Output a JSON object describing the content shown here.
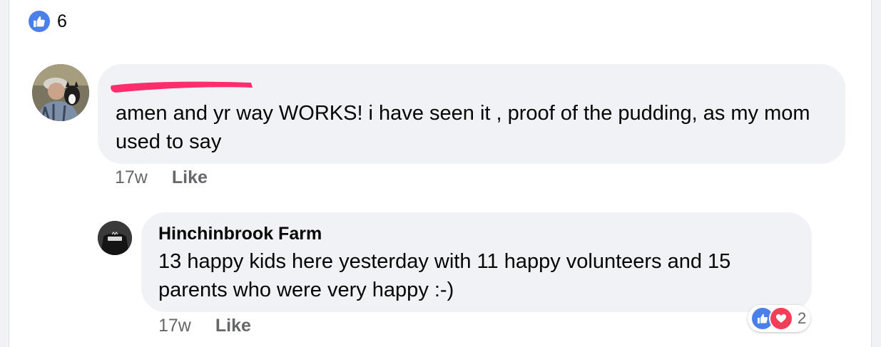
{
  "reaction_summary": {
    "icon": "like-icon",
    "count": "6",
    "color": "#4a80e8"
  },
  "comments": [
    {
      "author_redacted": true,
      "redaction_color": "#ff2d6b",
      "avatar": "user-photo-avatar",
      "text": "amen and yr way WORKS! i have seen it , proof of the pudding, as my mom used to say",
      "time": "17w",
      "like_label": "Like"
    },
    {
      "author": "Hinchinbrook Farm",
      "avatar": "farm-logo-avatar",
      "text": "13 happy kids here yesterday with 11 happy volunteers and 15 parents who were very happy :-)",
      "time": "17w",
      "like_label": "Like",
      "reactions": {
        "icons": [
          "like-icon",
          "love-icon"
        ],
        "count": "2"
      }
    }
  ]
}
